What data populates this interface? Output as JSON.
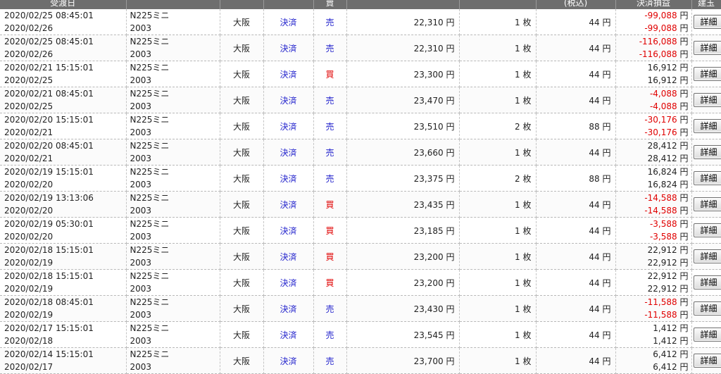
{
  "header": {
    "date": "受渡日",
    "symbol": "",
    "market": "",
    "trade_type": "",
    "side": "賣",
    "price": "",
    "quantity": "",
    "fee": "(税込)",
    "profit_loss": "決済損益",
    "detail": "建玉"
  },
  "detail_label": "詳細",
  "colors": {
    "sell": "#2222cc",
    "buy": "#e00000",
    "loss": "#e00000"
  },
  "rows": [
    {
      "datetime": "2020/02/25 08:45:01",
      "delivery": "2020/02/26",
      "symbol": "N225ミニ",
      "month": "2003",
      "market": "大阪",
      "type": "決済",
      "side": "売",
      "price": "22,310",
      "price_unit": "円",
      "qty": "1",
      "qty_unit": "枚",
      "fee": "44",
      "fee_unit": "円",
      "pl1": "-99,088",
      "pl2": "-99,088",
      "pl_unit": "円",
      "negative": true
    },
    {
      "datetime": "2020/02/25 08:45:01",
      "delivery": "2020/02/26",
      "symbol": "N225ミニ",
      "month": "2003",
      "market": "大阪",
      "type": "決済",
      "side": "売",
      "price": "22,310",
      "price_unit": "円",
      "qty": "1",
      "qty_unit": "枚",
      "fee": "44",
      "fee_unit": "円",
      "pl1": "-116,088",
      "pl2": "-116,088",
      "pl_unit": "円",
      "negative": true
    },
    {
      "datetime": "2020/02/21 15:15:01",
      "delivery": "2020/02/25",
      "symbol": "N225ミニ",
      "month": "2003",
      "market": "大阪",
      "type": "決済",
      "side": "買",
      "price": "23,300",
      "price_unit": "円",
      "qty": "1",
      "qty_unit": "枚",
      "fee": "44",
      "fee_unit": "円",
      "pl1": "16,912",
      "pl2": "16,912",
      "pl_unit": "円",
      "negative": false
    },
    {
      "datetime": "2020/02/21 08:45:01",
      "delivery": "2020/02/25",
      "symbol": "N225ミニ",
      "month": "2003",
      "market": "大阪",
      "type": "決済",
      "side": "売",
      "price": "23,470",
      "price_unit": "円",
      "qty": "1",
      "qty_unit": "枚",
      "fee": "44",
      "fee_unit": "円",
      "pl1": "-4,088",
      "pl2": "-4,088",
      "pl_unit": "円",
      "negative": true
    },
    {
      "datetime": "2020/02/20 15:15:01",
      "delivery": "2020/02/21",
      "symbol": "N225ミニ",
      "month": "2003",
      "market": "大阪",
      "type": "決済",
      "side": "売",
      "price": "23,510",
      "price_unit": "円",
      "qty": "2",
      "qty_unit": "枚",
      "fee": "88",
      "fee_unit": "円",
      "pl1": "-30,176",
      "pl2": "-30,176",
      "pl_unit": "円",
      "negative": true
    },
    {
      "datetime": "2020/02/20 08:45:01",
      "delivery": "2020/02/21",
      "symbol": "N225ミニ",
      "month": "2003",
      "market": "大阪",
      "type": "決済",
      "side": "売",
      "price": "23,660",
      "price_unit": "円",
      "qty": "1",
      "qty_unit": "枚",
      "fee": "44",
      "fee_unit": "円",
      "pl1": "28,412",
      "pl2": "28,412",
      "pl_unit": "円",
      "negative": false
    },
    {
      "datetime": "2020/02/19 15:15:01",
      "delivery": "2020/02/20",
      "symbol": "N225ミニ",
      "month": "2003",
      "market": "大阪",
      "type": "決済",
      "side": "売",
      "price": "23,375",
      "price_unit": "円",
      "qty": "2",
      "qty_unit": "枚",
      "fee": "88",
      "fee_unit": "円",
      "pl1": "16,824",
      "pl2": "16,824",
      "pl_unit": "円",
      "negative": false
    },
    {
      "datetime": "2020/02/19 13:13:06",
      "delivery": "2020/02/20",
      "symbol": "N225ミニ",
      "month": "2003",
      "market": "大阪",
      "type": "決済",
      "side": "買",
      "price": "23,435",
      "price_unit": "円",
      "qty": "1",
      "qty_unit": "枚",
      "fee": "44",
      "fee_unit": "円",
      "pl1": "-14,588",
      "pl2": "-14,588",
      "pl_unit": "円",
      "negative": true
    },
    {
      "datetime": "2020/02/19 05:30:01",
      "delivery": "2020/02/20",
      "symbol": "N225ミニ",
      "month": "2003",
      "market": "大阪",
      "type": "決済",
      "side": "買",
      "price": "23,185",
      "price_unit": "円",
      "qty": "1",
      "qty_unit": "枚",
      "fee": "44",
      "fee_unit": "円",
      "pl1": "-3,588",
      "pl2": "-3,588",
      "pl_unit": "円",
      "negative": true
    },
    {
      "datetime": "2020/02/18 15:15:01",
      "delivery": "2020/02/19",
      "symbol": "N225ミニ",
      "month": "2003",
      "market": "大阪",
      "type": "決済",
      "side": "買",
      "price": "23,200",
      "price_unit": "円",
      "qty": "1",
      "qty_unit": "枚",
      "fee": "44",
      "fee_unit": "円",
      "pl1": "22,912",
      "pl2": "22,912",
      "pl_unit": "円",
      "negative": false
    },
    {
      "datetime": "2020/02/18 15:15:01",
      "delivery": "2020/02/19",
      "symbol": "N225ミニ",
      "month": "2003",
      "market": "大阪",
      "type": "決済",
      "side": "買",
      "price": "23,200",
      "price_unit": "円",
      "qty": "1",
      "qty_unit": "枚",
      "fee": "44",
      "fee_unit": "円",
      "pl1": "22,912",
      "pl2": "22,912",
      "pl_unit": "円",
      "negative": false
    },
    {
      "datetime": "2020/02/18 08:45:01",
      "delivery": "2020/02/19",
      "symbol": "N225ミニ",
      "month": "2003",
      "market": "大阪",
      "type": "決済",
      "side": "売",
      "price": "23,430",
      "price_unit": "円",
      "qty": "1",
      "qty_unit": "枚",
      "fee": "44",
      "fee_unit": "円",
      "pl1": "-11,588",
      "pl2": "-11,588",
      "pl_unit": "円",
      "negative": true
    },
    {
      "datetime": "2020/02/17 15:15:01",
      "delivery": "2020/02/18",
      "symbol": "N225ミニ",
      "month": "2003",
      "market": "大阪",
      "type": "決済",
      "side": "売",
      "price": "23,545",
      "price_unit": "円",
      "qty": "1",
      "qty_unit": "枚",
      "fee": "44",
      "fee_unit": "円",
      "pl1": "1,412",
      "pl2": "1,412",
      "pl_unit": "円",
      "negative": false
    },
    {
      "datetime": "2020/02/14 15:15:01",
      "delivery": "2020/02/17",
      "symbol": "N225ミニ",
      "month": "2003",
      "market": "大阪",
      "type": "決済",
      "side": "売",
      "price": "23,700",
      "price_unit": "円",
      "qty": "1",
      "qty_unit": "枚",
      "fee": "44",
      "fee_unit": "円",
      "pl1": "6,412",
      "pl2": "6,412",
      "pl_unit": "円",
      "negative": false
    }
  ]
}
